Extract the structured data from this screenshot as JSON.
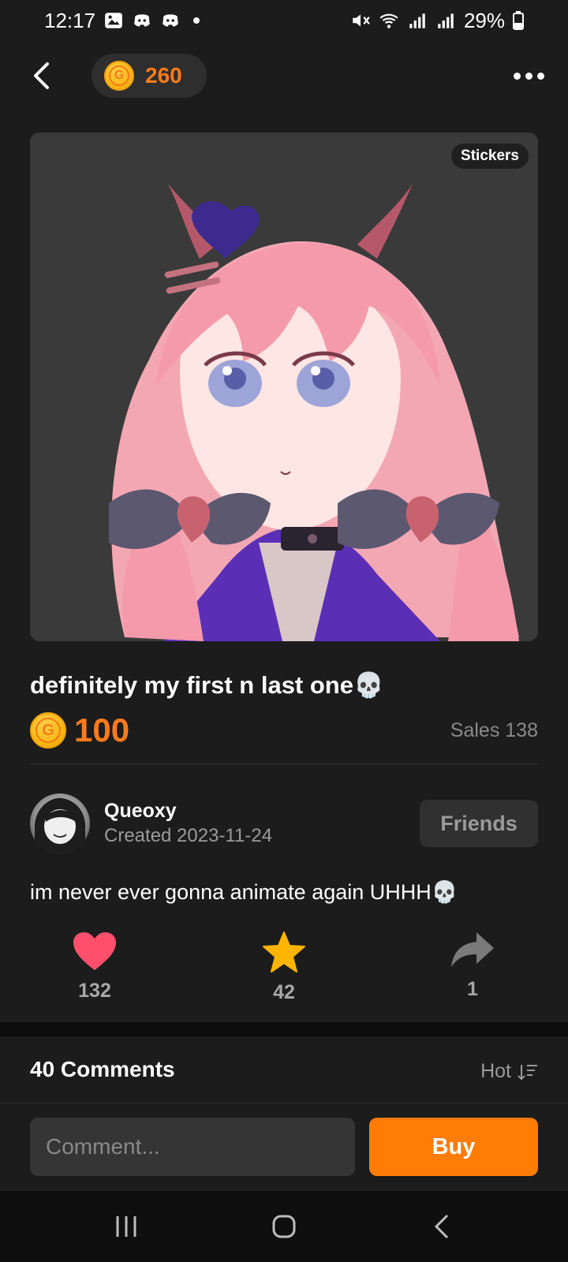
{
  "status_bar": {
    "time": "12:17",
    "battery": "29%"
  },
  "header": {
    "coin_balance": "260"
  },
  "sticker": {
    "tag": "Stickers",
    "title": "definitely my first n last one💀",
    "price": "100",
    "sales": "Sales 138"
  },
  "author": {
    "name": "Queoxy",
    "created": "Created 2023-11-24",
    "friends_label": "Friends"
  },
  "description": "im never ever gonna animate again UHHH💀",
  "actions": {
    "likes": "132",
    "favorites": "42",
    "shares": "1"
  },
  "comments": {
    "title": "40 Comments",
    "sort_label": "Hot"
  },
  "bottom": {
    "comment_placeholder": "Comment...",
    "buy_label": "Buy"
  },
  "colors": {
    "accent": "#ff7c05",
    "background": "#1c1c1c",
    "heart": "#ff4f6d",
    "star": "#ffb400"
  },
  "icons": [
    "back-arrow-icon",
    "coin-icon",
    "more-icon",
    "heart-icon",
    "star-icon",
    "share-icon",
    "sort-icon",
    "recents-icon",
    "home-icon",
    "nav-back-icon"
  ]
}
